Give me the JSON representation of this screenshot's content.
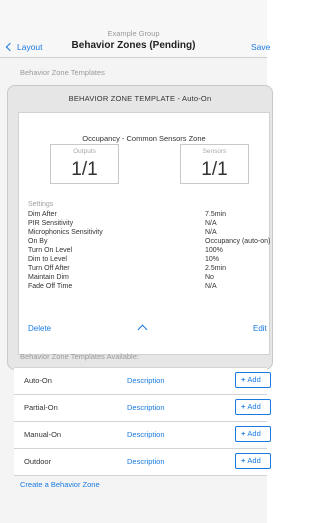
{
  "nav": {
    "subtitle": "Example Group",
    "back_label": "Layout",
    "title": "Behavior Zones (Pending)",
    "save_label": "Save"
  },
  "templates_section_label": "Behavior Zone Templates",
  "template_card": {
    "header": "BEHAVIOR ZONE TEMPLATE - Auto-On",
    "zone_name": "Occupancy - Common Sensors Zone",
    "outputs": {
      "label": "Outputs",
      "value": "1/1"
    },
    "sensors": {
      "label": "Sensors",
      "value": "1/1"
    },
    "settings_label": "Settings",
    "settings": [
      {
        "key": "Dim After",
        "value": "7.5min"
      },
      {
        "key": "PIR Sensitivity",
        "value": "N/A"
      },
      {
        "key": "Microphonics Sensitivity",
        "value": "N/A"
      },
      {
        "key": "On By",
        "value": "Occupancy (auto-on)"
      },
      {
        "key": "Turn On Level",
        "value": "100%"
      },
      {
        "key": "Dim to Level",
        "value": "10%"
      },
      {
        "key": "Turn Off After",
        "value": "2.5min"
      },
      {
        "key": "Maintain Dim",
        "value": "No"
      },
      {
        "key": "Fade Off Time",
        "value": "N/A"
      }
    ],
    "delete_label": "Delete",
    "edit_label": "Edit"
  },
  "available_section_label": "Behavior Zone Templates Available:",
  "available": [
    {
      "name": "Auto-On",
      "description": "Description",
      "add_label": "Add"
    },
    {
      "name": "Partial-On",
      "description": "Description",
      "add_label": "Add"
    },
    {
      "name": "Manual-On",
      "description": "Description",
      "add_label": "Add"
    },
    {
      "name": "Outdoor",
      "description": "Description",
      "add_label": "Add"
    }
  ],
  "create_link": "Create a Behavior Zone",
  "colors": {
    "accent": "#1a7ae0",
    "background": "#f4f4f4",
    "card": "#e6e6e6"
  }
}
